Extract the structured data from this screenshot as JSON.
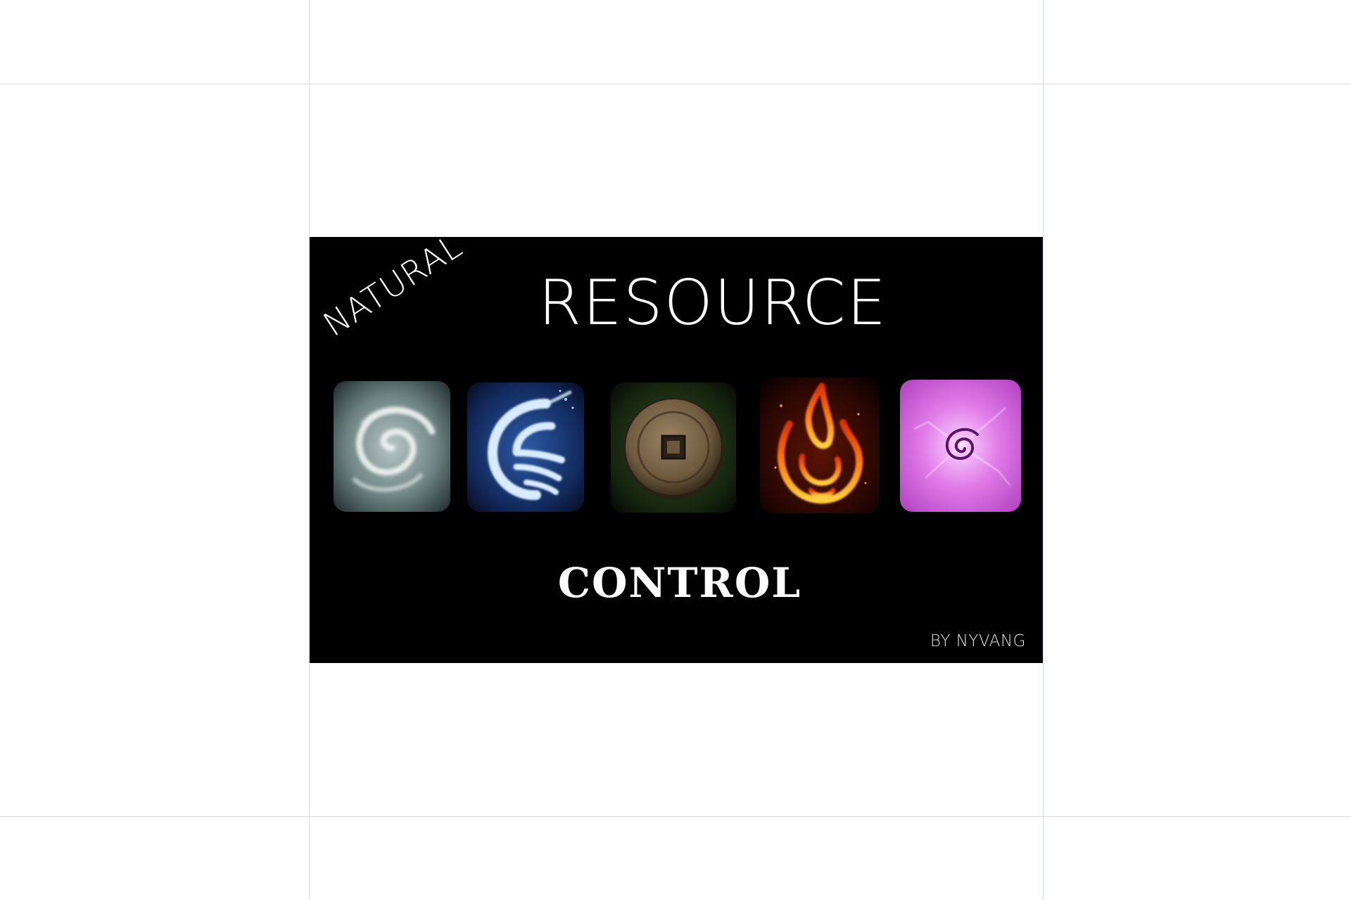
{
  "poster": {
    "word_natural": "NATURAL",
    "word_resource": "RESOURCE",
    "word_control": "CONTROL",
    "credit": "BY NYVANG"
  },
  "tiles": [
    {
      "name": "air",
      "icon": "air-swirl-icon",
      "color": "#8a9ea0"
    },
    {
      "name": "water",
      "icon": "water-wave-icon",
      "color": "#1d3f7a"
    },
    {
      "name": "earth",
      "icon": "earth-coin-icon",
      "color": "#6b5a40"
    },
    {
      "name": "fire",
      "icon": "fire-flame-icon",
      "color": "#ff6a10"
    },
    {
      "name": "spirit",
      "icon": "spirit-spiral-icon",
      "color": "#e070e8"
    }
  ],
  "colors": {
    "page_background": "#ffffff",
    "slide_background": "#000000",
    "text": "#ffffff",
    "guide_lines": "#c9dcf3"
  }
}
